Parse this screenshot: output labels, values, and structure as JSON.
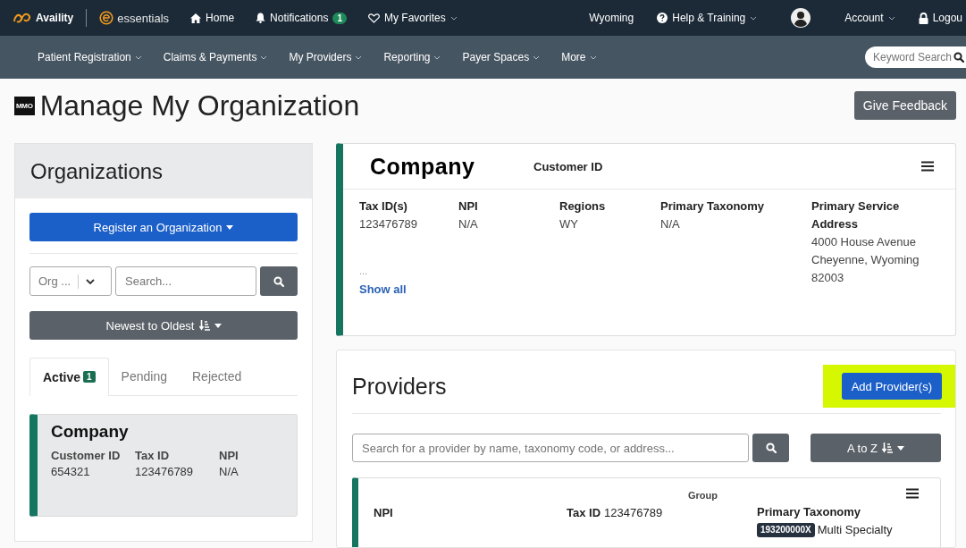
{
  "topbar": {
    "brand": "Availity",
    "product": "essentials",
    "left_items": [
      {
        "kind": "home",
        "label": "Home"
      },
      {
        "kind": "bell",
        "label": "Notifications",
        "badge": "1"
      },
      {
        "kind": "heart",
        "label": "My Favorites",
        "dropdown": true
      }
    ],
    "right_items": [
      {
        "kind": "plain",
        "label": "Wyoming"
      },
      {
        "kind": "help",
        "label": "Help & Training",
        "dropdown": true
      },
      {
        "kind": "avatar"
      },
      {
        "kind": "plain",
        "label": "Account",
        "dropdown": true
      },
      {
        "kind": "lock",
        "label": "Logou"
      }
    ]
  },
  "nav": {
    "items": [
      {
        "label": "Patient Registration",
        "dropdown": true
      },
      {
        "label": "Claims & Payments",
        "dropdown": true
      },
      {
        "label": "My Providers",
        "dropdown": true
      },
      {
        "label": "Reporting",
        "dropdown": true
      },
      {
        "label": "Payer Spaces",
        "dropdown": true
      },
      {
        "label": "More",
        "dropdown": true
      }
    ],
    "search": {
      "placeholder": "Keyword Search"
    }
  },
  "page": {
    "logo": "MMO",
    "title": "Manage My Organization",
    "feedback_button": "Give Feedback"
  },
  "organizations": {
    "title": "Organizations",
    "register_button": "Register an Organization",
    "filter_select": "Org ...",
    "search": {
      "placeholder": "Search..."
    },
    "sort_button": "Newest to Oldest",
    "tabs": [
      {
        "label": "Active",
        "badge": "1",
        "selected": true
      },
      {
        "label": "Pending",
        "selected": false
      },
      {
        "label": "Rejected",
        "selected": false
      }
    ],
    "cards": [
      {
        "name": "Company",
        "fields": [
          {
            "label": "Customer ID",
            "value": "654321"
          },
          {
            "label": "Tax ID",
            "value": "123476789"
          },
          {
            "label": "NPI",
            "value": "N/A"
          }
        ]
      }
    ]
  },
  "company": {
    "name": "Company",
    "customer_id_label": "Customer ID",
    "columns": [
      {
        "label": "Tax ID(s)",
        "lines": [
          "123476789"
        ],
        "more": "...",
        "link": "Show all"
      },
      {
        "label": "NPI",
        "lines": [
          "N/A"
        ]
      },
      {
        "label": "Regions",
        "lines": [
          "WY"
        ]
      },
      {
        "label": "Primary Taxonomy",
        "lines": [
          "N/A"
        ]
      },
      {
        "label": "Primary Service Address",
        "lines": [
          "4000 House Avenue",
          "Cheyenne, Wyoming",
          "82003"
        ]
      }
    ]
  },
  "providers": {
    "title": "Providers",
    "add_button": {
      "label": "Add Provider(s)",
      "highlighted": true
    },
    "search": {
      "placeholder": "Search for a provider by name, taxonomy code, or address..."
    },
    "sort_button": "A to Z",
    "items": [
      {
        "type": "Group",
        "npi_label": "NPI",
        "tax_label": "Tax ID",
        "tax_value": "123476789",
        "taxonomy_label": "Primary Taxonomy",
        "taxonomy_code": "193200000X",
        "taxonomy_name": "Multi Specialty"
      }
    ]
  }
}
